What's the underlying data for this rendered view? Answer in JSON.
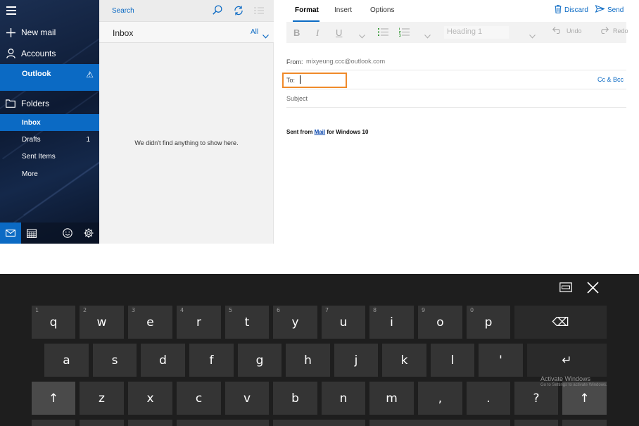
{
  "nav": {
    "new_mail": "New mail",
    "accounts": "Accounts",
    "account_name": "Outlook",
    "warning_glyph": "⚠",
    "folders": "Folders",
    "folder_items": [
      {
        "label": "Inbox",
        "count": ""
      },
      {
        "label": "Drafts",
        "count": "1"
      },
      {
        "label": "Sent Items",
        "count": ""
      },
      {
        "label": "More",
        "count": ""
      }
    ],
    "accent_color": "#0b6ac4"
  },
  "list": {
    "search_placeholder": "Search",
    "title": "Inbox",
    "filter": "All",
    "empty_message": "We didn't find anything to show here."
  },
  "compose": {
    "tabs": [
      "Format",
      "Insert",
      "Options"
    ],
    "discard": "Discard",
    "send": "Send",
    "toolbar": {
      "bold": "B",
      "italic": "I",
      "underline": "U",
      "heading": "Heading 1",
      "undo": "Undo",
      "redo": "Redo"
    },
    "from_label": "From:",
    "from_value": "mixyeung.ccc@outlook.com",
    "to_label": "To:",
    "to_value": "",
    "cc_bcc": "Cc & Bcc",
    "subject_placeholder": "Subject",
    "signature_prefix": "Sent from ",
    "signature_link": "Mail",
    "signature_suffix": " for Windows 10",
    "highlight_color": "#f08a2a"
  },
  "keyboard": {
    "row1": [
      {
        "k": "q",
        "h": "1"
      },
      {
        "k": "w",
        "h": "2"
      },
      {
        "k": "e",
        "h": "3"
      },
      {
        "k": "r",
        "h": "4"
      },
      {
        "k": "t",
        "h": "5"
      },
      {
        "k": "y",
        "h": "6"
      },
      {
        "k": "u",
        "h": "7"
      },
      {
        "k": "i",
        "h": "8"
      },
      {
        "k": "o",
        "h": "9"
      },
      {
        "k": "p",
        "h": "0"
      }
    ],
    "row2": [
      "a",
      "s",
      "d",
      "f",
      "g",
      "h",
      "j",
      "k",
      "l",
      "'"
    ],
    "row3": [
      "z",
      "x",
      "c",
      "v",
      "b",
      "n",
      "m",
      ",",
      ".",
      "?"
    ],
    "shift_glyph": "↑",
    "backspace_glyph": "⌫",
    "enter_glyph": "↵"
  },
  "watermark": {
    "line1": "Activate Windows",
    "line2": "Go to Settings to activate Windows."
  }
}
